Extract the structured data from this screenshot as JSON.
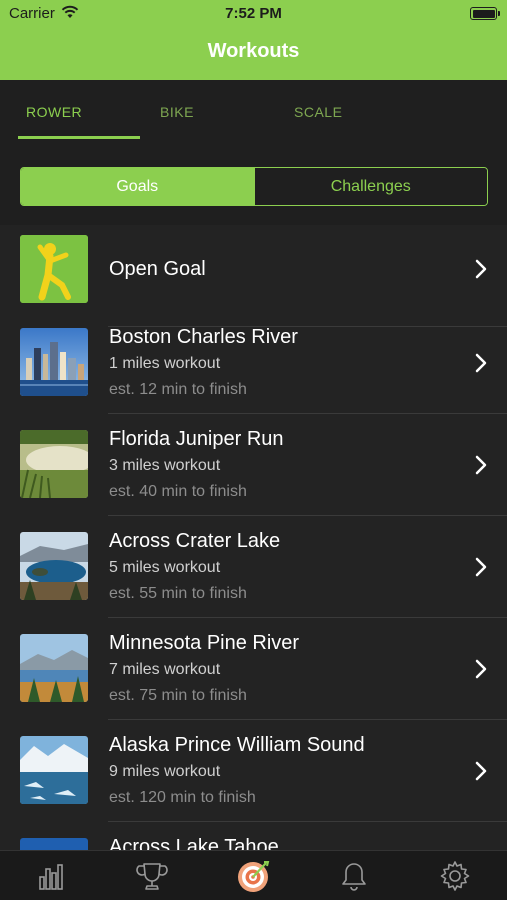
{
  "status_bar": {
    "carrier": "Carrier",
    "time": "7:52 PM"
  },
  "header": {
    "title": "Workouts"
  },
  "tabs": [
    {
      "label": "ROWER",
      "active": true
    },
    {
      "label": "BIKE",
      "active": false
    },
    {
      "label": "SCALE",
      "active": false
    }
  ],
  "segment": {
    "goals": "Goals",
    "challenges": "Challenges",
    "selected": "Goals"
  },
  "workouts": [
    {
      "name": "Open Goal",
      "thumb": "stick-figure-icon"
    },
    {
      "name": "Boston Charles River",
      "distance": "1 miles workout",
      "estimate": "est. 12 min to finish",
      "thumb": "boston-skyline-photo"
    },
    {
      "name": "Florida Juniper Run",
      "distance": "3 miles workout",
      "estimate": "est. 40 min to finish",
      "thumb": "florida-river-photo"
    },
    {
      "name": "Across Crater Lake",
      "distance": "5 miles workout",
      "estimate": "est. 55 min to finish",
      "thumb": "crater-lake-photo"
    },
    {
      "name": "Minnesota Pine River",
      "distance": "7 miles workout",
      "estimate": "est. 75 min to finish",
      "thumb": "pine-river-photo"
    },
    {
      "name": "Alaska Prince William Sound",
      "distance": "9 miles workout",
      "estimate": "est. 120 min to finish",
      "thumb": "alaska-glacier-photo"
    },
    {
      "name": "Across Lake Tahoe",
      "thumb": "lake-tahoe-photo"
    }
  ],
  "tabbar": [
    "stats-icon",
    "trophy-icon",
    "target-icon",
    "bell-icon",
    "gear-icon"
  ],
  "colors": {
    "accent": "#8ccf4f",
    "background": "#1f1f1f",
    "row_background": "#232323"
  }
}
